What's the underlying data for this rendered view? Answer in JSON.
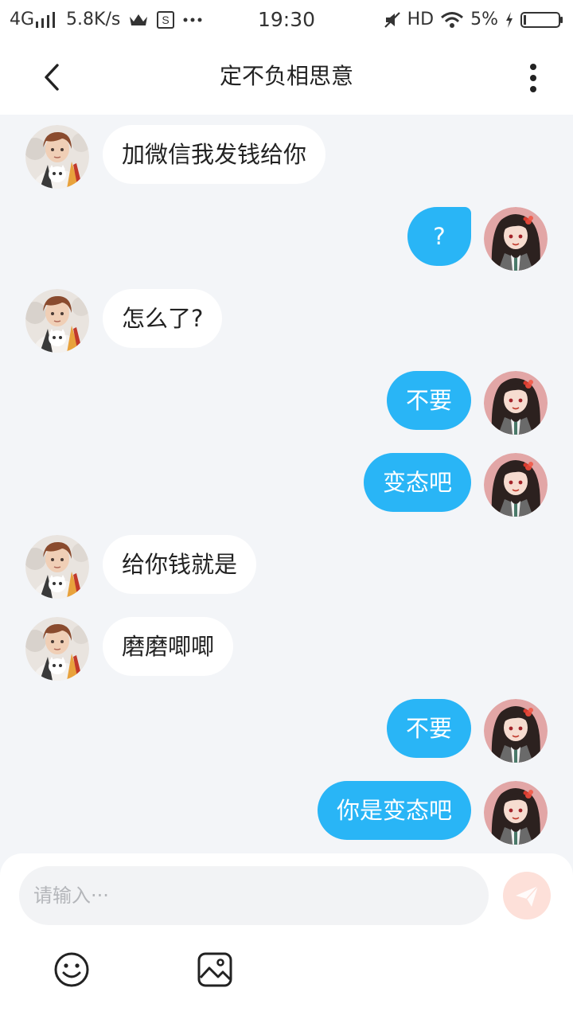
{
  "status_bar": {
    "network": "4G",
    "speed": "5.8K/s",
    "time": "19:30",
    "hd": "HD",
    "battery": "5%"
  },
  "header": {
    "title": "定不负相思意"
  },
  "messages": [
    {
      "side": "in",
      "text": "加微信我发钱给你"
    },
    {
      "side": "out",
      "text": "?"
    },
    {
      "side": "in",
      "text": "怎么了?"
    },
    {
      "side": "out",
      "text": "不要"
    },
    {
      "side": "out",
      "text": "变态吧"
    },
    {
      "side": "in",
      "text": "给你钱就是"
    },
    {
      "side": "in",
      "text": "磨磨唧唧"
    },
    {
      "side": "out",
      "text": "不要"
    },
    {
      "side": "out",
      "text": "你是变态吧"
    }
  ],
  "composer": {
    "placeholder": "请输入···",
    "value": ""
  },
  "icons": {
    "back": "chevron-left-icon",
    "more": "more-vertical-icon",
    "send": "paper-plane-icon",
    "emoji": "smiley-icon",
    "image": "image-icon"
  },
  "colors": {
    "outgoing_bubble": "#29b5f6",
    "incoming_bubble": "#ffffff",
    "chat_background": "#f3f5f8",
    "send_button": "#fde0d9"
  }
}
